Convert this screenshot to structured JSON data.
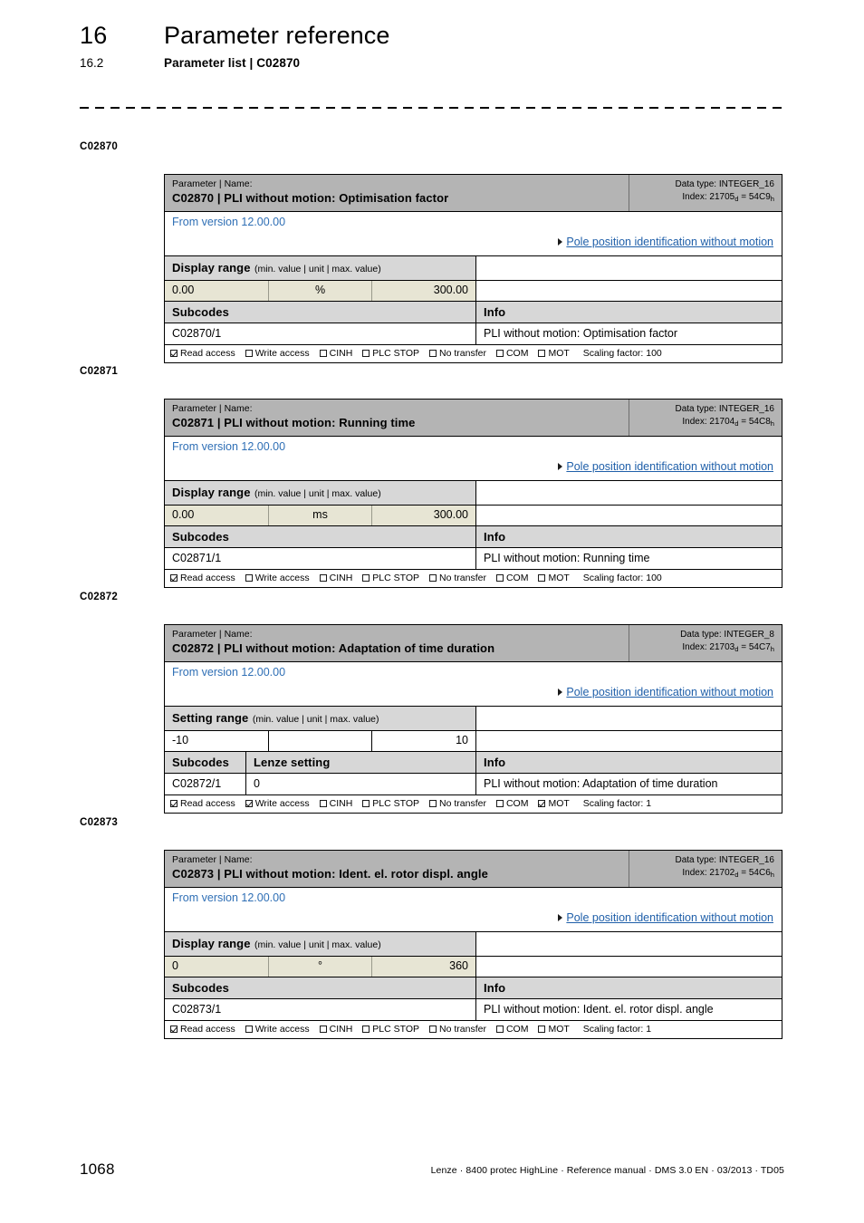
{
  "header": {
    "chapter_number": "16",
    "chapter_title": "Parameter reference",
    "section_number": "16.2",
    "section_title": "Parameter list | C02870"
  },
  "footer": {
    "page_number": "1068",
    "reference": "Lenze · 8400 protec HighLine · Reference manual · DMS 3.0 EN · 03/2013 · TD05"
  },
  "labels": {
    "parameter_name_caption": "Parameter | Name:",
    "link_text": "Pole position identification without motion",
    "subcodes": "Subcodes",
    "info": "Info",
    "lenze_setting": "Lenze setting",
    "display_range": "Display range",
    "setting_range": "Setting range",
    "range_hint": "(min. value | unit | max. value)",
    "flag_read": "Read access",
    "flag_write": "Write access",
    "flag_cinh": "CINH",
    "flag_plcstop": "PLC STOP",
    "flag_notransfer": "No transfer",
    "flag_com": "COM",
    "flag_mot": "MOT"
  },
  "colors": {
    "header_band": "#b4b4b4",
    "subhead_band": "#d7d7d7",
    "value_beige": "#e7e5d4",
    "link_blue": "#1f5fa9",
    "version_blue": "#2f6fb5"
  },
  "parameters": [
    {
      "margin_label": "C02870",
      "code": "C02870",
      "name": "PLI without motion: Optimisation factor",
      "title": "C02870 | PLI without motion: Optimisation factor",
      "data_type": "Data type: INTEGER_16",
      "index_prefix": "Index: 21705",
      "index_dec_sub": "d",
      "index_eq": " = 54C9",
      "index_hex_sub": "h",
      "version": "From version 12.00.00",
      "range_title": "Display range",
      "range_hint": "(min. value | unit | max. value)",
      "min": "0.00",
      "unit": "%",
      "max": "300.00",
      "value_shading": "beige",
      "has_lenze_setting": false,
      "subcode": "C02870/1",
      "lenze_setting_value": "",
      "info": "PLI without motion: Optimisation factor",
      "flags": {
        "read": true,
        "write": false,
        "cinh": false,
        "plc_stop": false,
        "no_transfer": false,
        "com": false,
        "mot": false
      },
      "scaling": "Scaling factor: 100"
    },
    {
      "margin_label": "C02871",
      "code": "C02871",
      "name": "PLI without motion: Running time",
      "title": "C02871 | PLI without motion: Running time",
      "data_type": "Data type: INTEGER_16",
      "index_prefix": "Index: 21704",
      "index_dec_sub": "d",
      "index_eq": " = 54C8",
      "index_hex_sub": "h",
      "version": "From version 12.00.00",
      "range_title": "Display range",
      "range_hint": "(min. value | unit | max. value)",
      "min": "0.00",
      "unit": "ms",
      "max": "300.00",
      "value_shading": "beige",
      "has_lenze_setting": false,
      "subcode": "C02871/1",
      "lenze_setting_value": "",
      "info": "PLI without motion: Running time",
      "flags": {
        "read": true,
        "write": false,
        "cinh": false,
        "plc_stop": false,
        "no_transfer": false,
        "com": false,
        "mot": false
      },
      "scaling": "Scaling factor: 100"
    },
    {
      "margin_label": "C02872",
      "code": "C02872",
      "name": "PLI without motion: Adaptation of time duration",
      "title": "C02872 | PLI without motion: Adaptation of time duration",
      "data_type": "Data type: INTEGER_8",
      "index_prefix": "Index: 21703",
      "index_dec_sub": "d",
      "index_eq": " = 54C7",
      "index_hex_sub": "h",
      "version": "From version 12.00.00",
      "range_title": "Setting range",
      "range_hint": "(min. value | unit | max. value)",
      "min": "-10",
      "unit": "",
      "max": "10",
      "value_shading": "white",
      "has_lenze_setting": true,
      "subcode": "C02872/1",
      "lenze_setting_value": "0",
      "info": "PLI without motion: Adaptation of time duration",
      "flags": {
        "read": true,
        "write": true,
        "cinh": false,
        "plc_stop": false,
        "no_transfer": false,
        "com": false,
        "mot": true
      },
      "scaling": "Scaling factor: 1"
    },
    {
      "margin_label": "C02873",
      "code": "C02873",
      "name": "PLI without motion: Ident.  el. rotor displ. angle",
      "title": "C02873 | PLI without motion: Ident.  el. rotor displ. angle",
      "data_type": "Data type: INTEGER_16",
      "index_prefix": "Index: 21702",
      "index_dec_sub": "d",
      "index_eq": " = 54C6",
      "index_hex_sub": "h",
      "version": "From version 12.00.00",
      "range_title": "Display range",
      "range_hint": "(min. value | unit | max. value)",
      "min": "0",
      "unit": "°",
      "max": "360",
      "value_shading": "beige",
      "has_lenze_setting": false,
      "subcode": "C02873/1",
      "lenze_setting_value": "",
      "info": "PLI without motion: Ident.  el. rotor displ. angle",
      "flags": {
        "read": true,
        "write": false,
        "cinh": false,
        "plc_stop": false,
        "no_transfer": false,
        "com": false,
        "mot": false
      },
      "scaling": "Scaling factor: 1"
    }
  ]
}
